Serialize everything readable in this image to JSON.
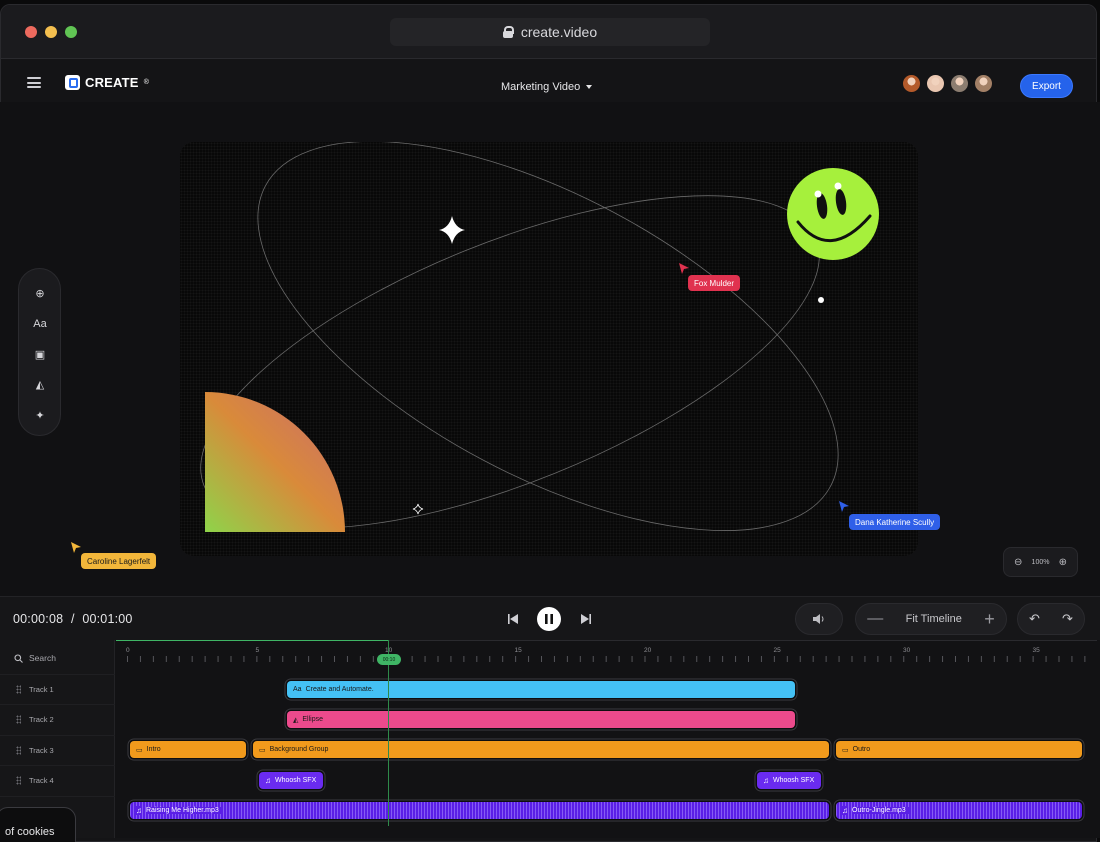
{
  "browser": {
    "url": "create.video"
  },
  "app": {
    "logo_text": "CREATE",
    "logo_sup": "®",
    "project_title": "Marketing Video",
    "export_label": "Export",
    "collaborators": [
      {
        "color": "#b45a2a"
      },
      {
        "color": "#e9c6b0"
      },
      {
        "color": "#8c7d70"
      },
      {
        "color": "#a38066"
      }
    ]
  },
  "tools": [
    {
      "name": "add-icon",
      "glyph": "⊕"
    },
    {
      "name": "text-icon",
      "glyph": "Aa"
    },
    {
      "name": "image-icon",
      "glyph": "▣"
    },
    {
      "name": "shapes-icon",
      "glyph": "◭"
    },
    {
      "name": "magic-wand-icon",
      "glyph": "✦"
    }
  ],
  "cursors": [
    {
      "name": "Fox Mulder",
      "color": "#e0324f"
    },
    {
      "name": "Dana Katherine Scully",
      "color": "#2f5fe8"
    },
    {
      "name": "Caroline Lagerfelt",
      "color": "#f2b63a"
    }
  ],
  "zoom": {
    "value": "100%"
  },
  "playback": {
    "current": "00:00:08",
    "separator": "/",
    "total": "00:01:00",
    "fit_label": "Fit Timeline",
    "playhead_label": "00:10"
  },
  "timeline": {
    "search_placeholder": "Search",
    "ruler_labels": [
      "0",
      "5",
      "10",
      "15",
      "20",
      "25",
      "30",
      "35"
    ],
    "tracks": [
      "Track 1",
      "Track 2",
      "Track 3",
      "Track 4",
      ""
    ],
    "clips": {
      "text": "Create and Automate.",
      "ellipse": "Ellipse",
      "intro": "Intro",
      "background_group": "Background Group",
      "outro": "Outro",
      "whoosh_1": "Whoosh SFX",
      "whoosh_2": "Whoosh SFX",
      "audio_1": "Raising Me Higher.mp3",
      "audio_2": "Outro-Jingle.mp3"
    }
  },
  "cookie_banner": {
    "text": "of cookies"
  },
  "colors": {
    "accent": "#2563eb",
    "smiley": "#a6f03c",
    "playhead": "#3fb565"
  }
}
